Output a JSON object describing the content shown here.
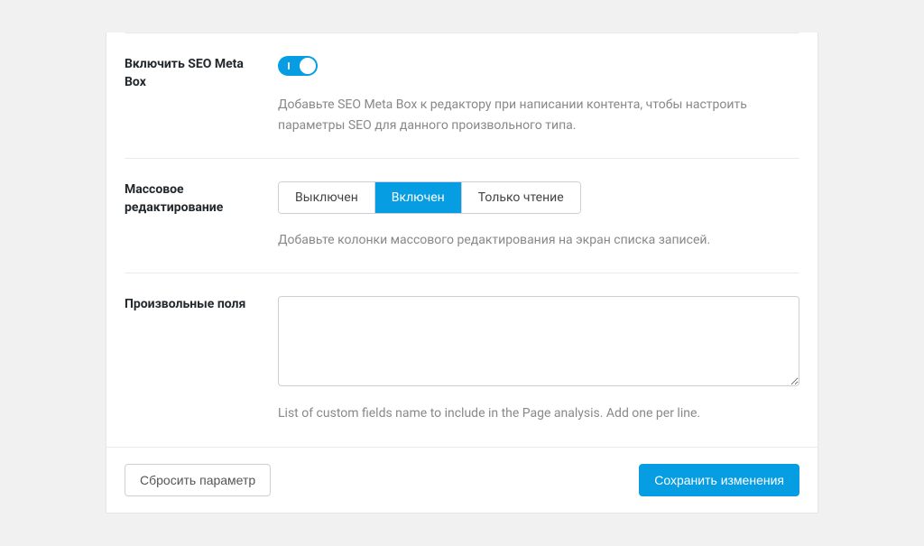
{
  "settings": {
    "seo_meta_box": {
      "label": "Включить SEO Meta Box",
      "enabled": true,
      "description": "Добавьте SEO Meta Box к редактору при написании контента, чтобы настроить параметры SEO для данного произвольного типа."
    },
    "bulk_editing": {
      "label": "Массовое редактирование",
      "options": [
        {
          "label": "Выключен",
          "value": "off",
          "active": false
        },
        {
          "label": "Включен",
          "value": "on",
          "active": true
        },
        {
          "label": "Только чтение",
          "value": "readonly",
          "active": false
        }
      ],
      "description": "Добавьте колонки массового редактирования на экран списка записей."
    },
    "custom_fields": {
      "label": "Произвольные поля",
      "value": "",
      "description": "List of custom fields name to include in the Page analysis. Add one per line."
    }
  },
  "footer": {
    "reset_label": "Сбросить параметр",
    "save_label": "Сохранить изменения"
  }
}
